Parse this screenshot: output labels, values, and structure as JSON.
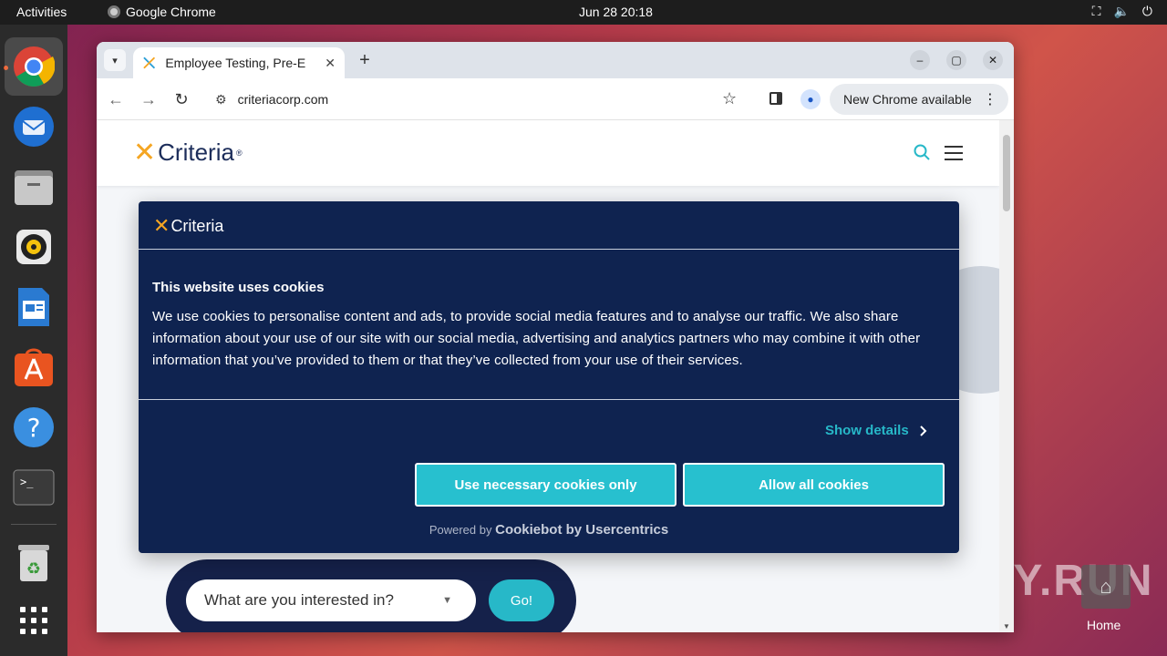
{
  "topbar": {
    "activities": "Activities",
    "app_name": "Google Chrome",
    "clock": "Jun 28  20:18"
  },
  "browser": {
    "tab_title": "Employee Testing, Pre-E",
    "url": "criteriacorp.com",
    "update_chip": "New Chrome available"
  },
  "site": {
    "logo_text": "Criteria",
    "logo_reg": "®",
    "interest_placeholder": "What are you interested in?",
    "go_label": "Go!"
  },
  "cookie": {
    "logo_text": "Criteria",
    "heading": "This website uses cookies",
    "body": "We use cookies to personalise content and ads, to provide social media features and to analyse our traffic. We also share information about your use of our site with our social media, advertising and analytics partners who may combine it with other information that you’ve provided to them or that they’ve collected from your use of their services.",
    "show_details": "Show details",
    "necessary_button": "Use necessary cookies only",
    "allow_all_button": "Allow all cookies",
    "powered_prefix": "Powered by",
    "powered_brand": "Cookiebot by Usercentrics"
  },
  "desktop": {
    "watermark": "ANY.RUN",
    "home_label": "Home"
  },
  "colors": {
    "accent_teal": "#27b8c8",
    "dialog_navy": "#0f2350",
    "brand_orange": "#f5a623",
    "brand_blue": "#2a9fd6"
  },
  "icons": [
    "chrome-icon",
    "thunderbird-icon",
    "files-icon",
    "rhythmbox-icon",
    "writer-icon",
    "appcenter-icon",
    "help-icon",
    "terminal-icon",
    "trash-icon",
    "apps-grid-icon",
    "search-icon",
    "menu-icon",
    "star-icon",
    "profile-icon"
  ]
}
